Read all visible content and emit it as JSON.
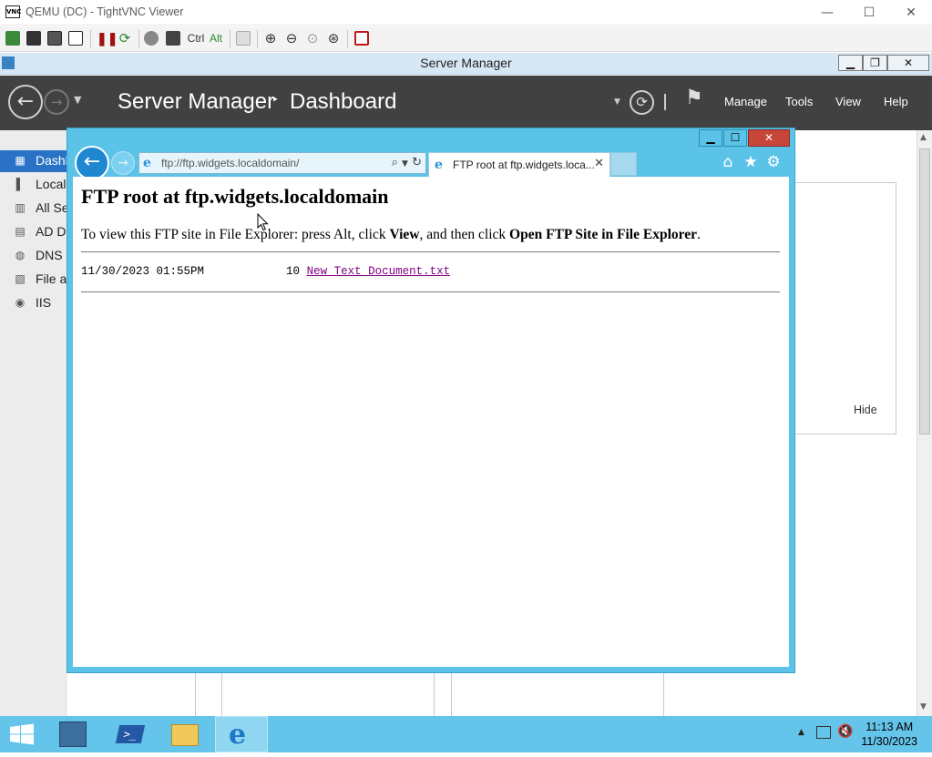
{
  "vnc": {
    "title": "QEMU (DC) - TightVNC Viewer",
    "minimize": "—",
    "maximize": "☐",
    "close": "✕",
    "toolbar": {
      "ctrl": "Ctrl",
      "alt": "Alt"
    }
  },
  "server_manager": {
    "window_title": "Server Manager",
    "breadcrumb": {
      "root": "Server Manager",
      "separator": "‣",
      "page": "Dashboard"
    },
    "menu": {
      "manage": "Manage",
      "tools": "Tools",
      "view": "View",
      "help": "Help"
    },
    "sidebar": {
      "items": [
        {
          "label": "Dashboard",
          "icon": "dashboard-icon"
        },
        {
          "label": "Local Server",
          "icon": "server-icon"
        },
        {
          "label": "All Servers",
          "icon": "servers-icon"
        },
        {
          "label": "AD DS",
          "icon": "ad-icon"
        },
        {
          "label": "DNS",
          "icon": "dns-icon"
        },
        {
          "label": "File and Storage Services",
          "icon": "file-icon"
        },
        {
          "label": "IIS",
          "icon": "iis-icon"
        }
      ]
    },
    "hide_label": "Hide",
    "window_controls": {
      "minimize": "▁",
      "restore": "❐",
      "close": "✕"
    }
  },
  "ie": {
    "address": "ftp://ftp.widgets.localdomain/",
    "tab_label": "FTP root at ftp.widgets.loca...",
    "window_controls": {
      "minimize": "▁",
      "maximize": "☐",
      "close": "✕"
    },
    "page": {
      "title": "FTP root at ftp.widgets.localdomain",
      "instruction_pre": "To view this FTP site in File Explorer: press Alt, click ",
      "instruction_view": "View",
      "instruction_mid": ", and then click ",
      "instruction_open": "Open FTP Site in File Explorer",
      "instruction_end": ".",
      "files": [
        {
          "date": "11/30/2023 01:55PM",
          "size": "10",
          "name": "New Text Document.txt"
        }
      ]
    }
  },
  "taskbar": {
    "time": "11:13 AM",
    "date": "11/30/2023"
  },
  "colors": {
    "ie_frame": "#5cc3e8",
    "sm_header": "#414141",
    "taskbar": "#64c4ea",
    "sidebar_active": "#2a72c6",
    "visited_link": "#800080"
  }
}
